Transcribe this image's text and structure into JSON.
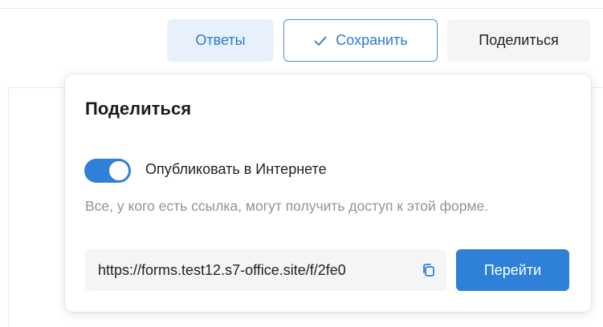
{
  "toolbar": {
    "answers_label": "Ответы",
    "save_label": "Сохранить",
    "share_label": "Поделиться"
  },
  "share_popover": {
    "title": "Поделиться",
    "publish_toggle": {
      "label": "Опубликовать в Интернете",
      "state": "on"
    },
    "hint": "Все, у кого есть ссылка, могут получить доступ к этой форме.",
    "link_value": "https://forms.test12.s7-office.site/f/2fe0",
    "go_button_label": "Перейти"
  },
  "colors": {
    "accent": "#2f80d8",
    "accent_light_bg": "#e8f1fb",
    "neutral_bg": "#f4f5f7",
    "hint_text": "#8e949c"
  },
  "icons": {
    "save": "check-icon",
    "copy": "copy-icon"
  }
}
